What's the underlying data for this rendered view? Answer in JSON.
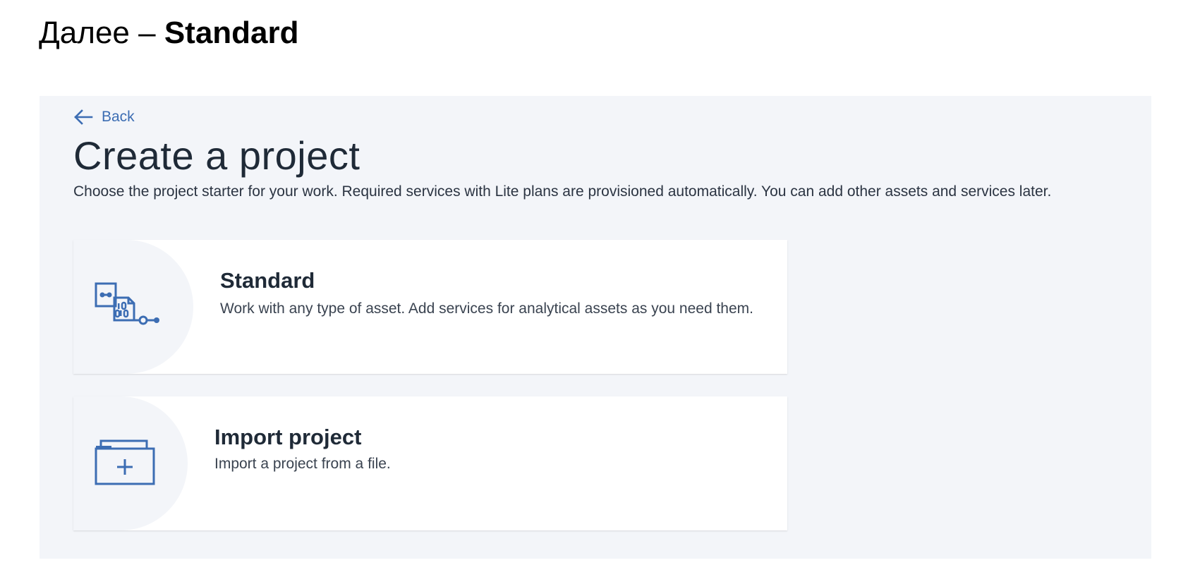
{
  "slide": {
    "heading_prefix": "Далее – ",
    "heading_bold": "Standard"
  },
  "nav": {
    "back_label": "Back",
    "back_icon": "arrow-left-icon"
  },
  "page": {
    "title": "Create a project",
    "description": "Choose the project starter for your work. Required services with Lite plans are provisioned automatically. You can add other assets and services later."
  },
  "options": [
    {
      "title": "Standard",
      "description": "Work with any type of asset. Add services for analytical assets as you need them.",
      "icon": "project-assets-icon"
    },
    {
      "title": "Import project",
      "description": "Import a project from a file.",
      "icon": "folder-add-icon"
    }
  ],
  "colors": {
    "accent": "#3c6db3",
    "panel_bg": "#f3f5f9",
    "tile_bg": "#ffffff",
    "text": "#1f2a37"
  }
}
